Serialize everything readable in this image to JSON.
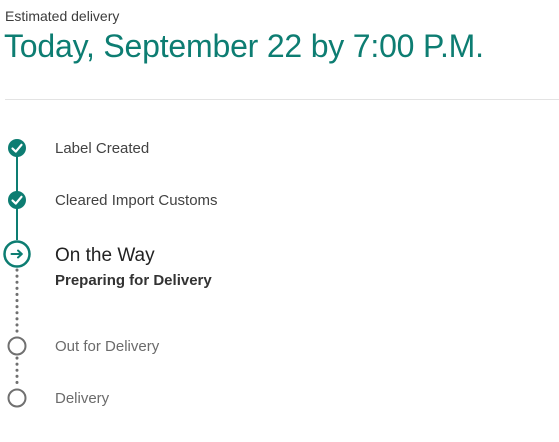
{
  "header": {
    "estimated_label": "Estimated delivery",
    "estimated_date": "Today, September 22 by 7:00 P.M."
  },
  "colors": {
    "accent": "#0d7d72",
    "pending": "#707070"
  },
  "timeline": {
    "steps": [
      {
        "label": "Label Created",
        "status": "completed",
        "icon": "check-icon"
      },
      {
        "label": "Cleared Import Customs",
        "status": "completed",
        "icon": "check-icon"
      },
      {
        "label": "On the Way",
        "status": "current",
        "sublabel": "Preparing for Delivery",
        "icon": "arrow-right-icon"
      },
      {
        "label": "Out for Delivery",
        "status": "pending",
        "icon": "empty-circle-icon"
      },
      {
        "label": "Delivery",
        "status": "pending",
        "icon": "empty-circle-icon"
      }
    ]
  }
}
